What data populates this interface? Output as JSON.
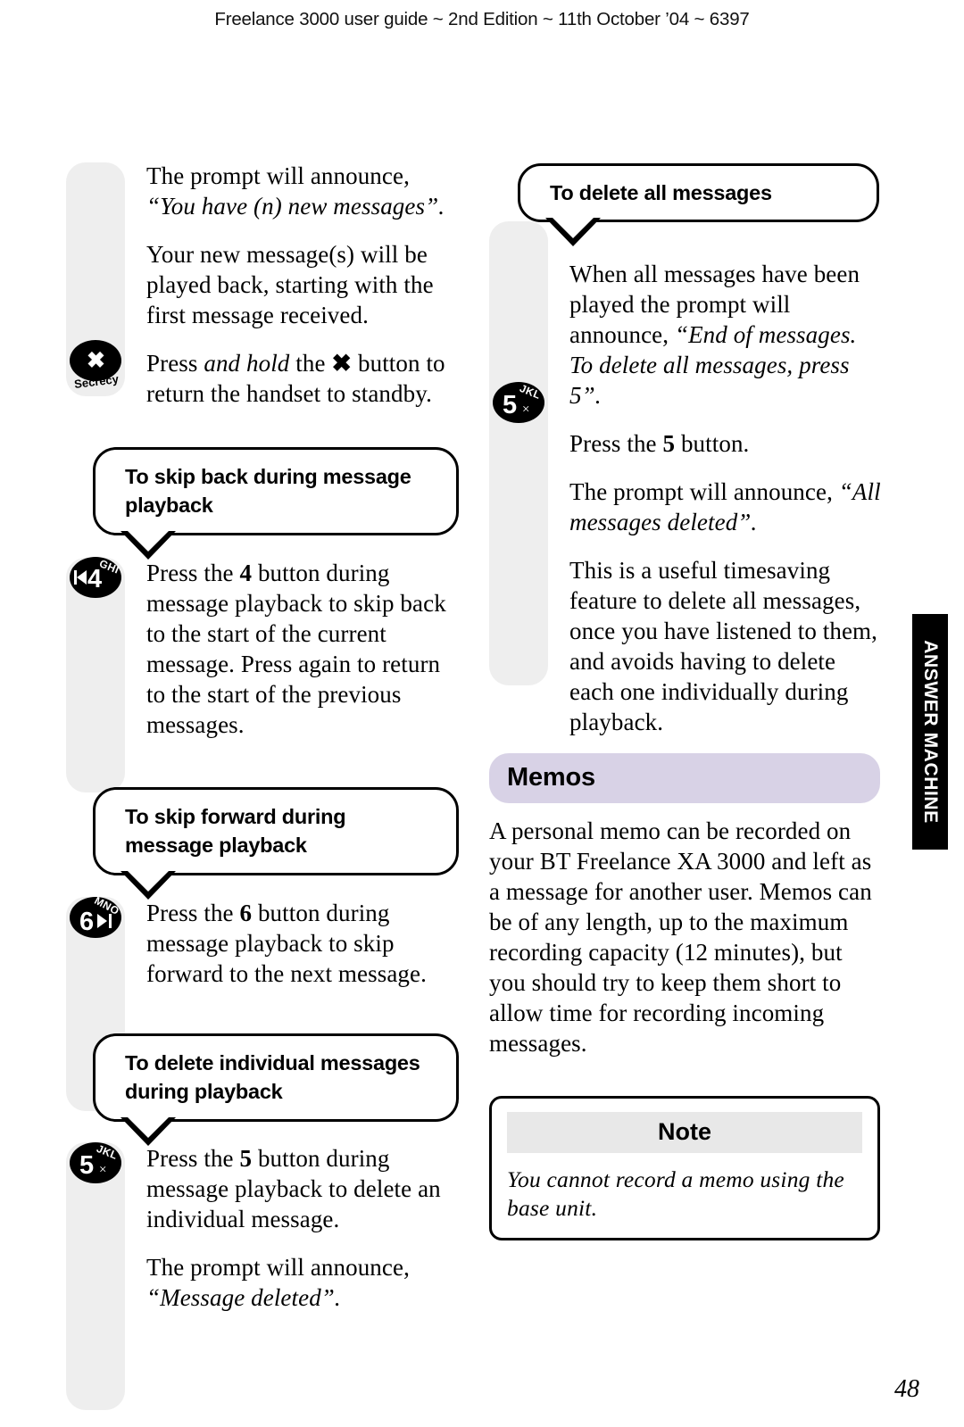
{
  "page": {
    "running_header": "Freelance 3000 user guide ~ 2nd Edition ~ 11th October ’04 ~ 6397",
    "folio": "48",
    "side_tab_label": "ANSWER MACHINE",
    "colors": {
      "strip_grey": "#eeeeee",
      "section_bar_lavender": "#d8d2e6",
      "note_head_grey": "#e8e8e8",
      "side_tab_bg": "#000000",
      "icon_bg": "#000000",
      "text": "#000000"
    }
  },
  "left_column": {
    "intro": {
      "icon": {
        "name": "secrecy-button-icon",
        "x_mark": "✖",
        "caption": "Secrecy"
      },
      "paragraphs": [
        {
          "id": "p1",
          "runs": [
            {
              "text": "The prompt will announce, ",
              "style": "normal"
            },
            {
              "text": "“You have (n) new messages”.",
              "style": "italic"
            }
          ]
        },
        {
          "id": "p2",
          "runs": [
            {
              "text": "Your new message(s) will be played back, starting with the first message received.",
              "style": "normal"
            }
          ]
        },
        {
          "id": "p3",
          "runs": [
            {
              "text": "Press ",
              "style": "normal"
            },
            {
              "text": "and hold",
              "style": "italic"
            },
            {
              "text": " the ",
              "style": "normal"
            },
            {
              "text": "✖",
              "style": "bold"
            },
            {
              "text": " button to return the handset to standby.",
              "style": "normal"
            }
          ]
        }
      ]
    },
    "sections": [
      {
        "id": "skip-back",
        "heading": "To skip back during message playback",
        "icon": {
          "name": "keypad-4-button-icon",
          "digit": "4",
          "letters": "GHI",
          "marker": "rewind"
        },
        "paragraphs": [
          {
            "id": "p1",
            "runs": [
              {
                "text": "Press the ",
                "style": "normal"
              },
              {
                "text": "4",
                "style": "bold"
              },
              {
                "text": " button during message playback to skip back to the start of the current message. Press again to return to the start of the previous messages.",
                "style": "normal"
              }
            ]
          }
        ]
      },
      {
        "id": "skip-forward",
        "heading": "To skip forward during message playback",
        "icon": {
          "name": "keypad-6-button-icon",
          "digit": "6",
          "letters": "MNO",
          "marker": "forward"
        },
        "paragraphs": [
          {
            "id": "p1",
            "runs": [
              {
                "text": "Press the ",
                "style": "normal"
              },
              {
                "text": "6",
                "style": "bold"
              },
              {
                "text": " button during message playback to skip forward to the next message.",
                "style": "normal"
              }
            ]
          }
        ]
      },
      {
        "id": "delete-individual",
        "heading": "To delete individual messages during playback",
        "icon": {
          "name": "keypad-5-button-icon",
          "digit": "5",
          "letters": "JKL",
          "marker": "×"
        },
        "paragraphs": [
          {
            "id": "p1",
            "runs": [
              {
                "text": "Press the ",
                "style": "normal"
              },
              {
                "text": "5",
                "style": "bold"
              },
              {
                "text": " button during message playback to delete an individual message.",
                "style": "normal"
              }
            ]
          },
          {
            "id": "p2",
            "runs": [
              {
                "text": "The prompt will announce, ",
                "style": "normal"
              },
              {
                "text": "“Message deleted”.",
                "style": "italic"
              }
            ]
          }
        ]
      }
    ]
  },
  "right_column": {
    "sections": [
      {
        "id": "delete-all",
        "heading": "To delete all messages",
        "icon": {
          "name": "keypad-5-button-icon",
          "digit": "5",
          "letters": "JKL",
          "marker": "×"
        },
        "paragraphs": [
          {
            "id": "p1",
            "runs": [
              {
                "text": "When all messages have been played the prompt will announce, ",
                "style": "normal"
              },
              {
                "text": "“End of messages. To delete all messages, press 5”.",
                "style": "italic"
              }
            ]
          },
          {
            "id": "p2",
            "runs": [
              {
                "text": "Press the ",
                "style": "normal"
              },
              {
                "text": "5",
                "style": "bold"
              },
              {
                "text": " button.",
                "style": "normal"
              }
            ]
          },
          {
            "id": "p3",
            "runs": [
              {
                "text": "The prompt will announce, ",
                "style": "normal"
              },
              {
                "text": "“All messages deleted”.",
                "style": "italic"
              }
            ]
          },
          {
            "id": "p4",
            "runs": [
              {
                "text": "This is a useful timesaving feature to delete all messages, once you have listened to them, and avoids having to delete each one individually during playback.",
                "style": "normal"
              }
            ]
          }
        ]
      }
    ],
    "memos": {
      "heading": "Memos",
      "body": "A personal memo can be recorded on your BT Freelance XA 3000 and left as a message for another user. Memos can be of any length, up to the maximum recording capacity (12 minutes), but you should try to keep them short to allow time for recording incoming messages."
    },
    "note": {
      "title": "Note",
      "body": "You cannot record a memo using the base unit."
    }
  }
}
